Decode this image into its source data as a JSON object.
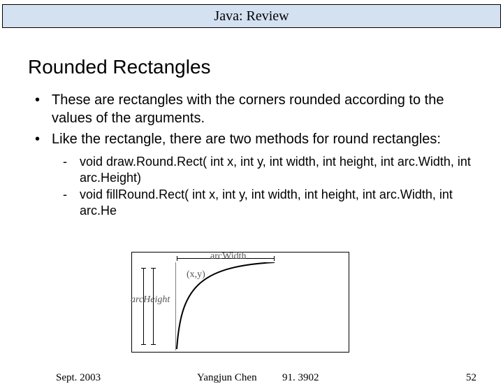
{
  "header": "Java: Review",
  "title": "Rounded Rectangles",
  "bullets": [
    "These are rectangles with the corners rounded according to\nthe values of the arguments.",
    "Like the rectangle, there are two methods for round rectangles:"
  ],
  "subitems": [
    "void draw.Round.Rect( int x, int y, int width, int height, int arc.Width, int arc.Height)",
    "void fillRound.Rect( int x, int y, int width, int height, int arc.Width, int arc.He"
  ],
  "diagram": {
    "arcWidth": "arcWidth",
    "xy": "(x,y)",
    "arcHeight": "arcHeight"
  },
  "footer": {
    "date": "Sept. 2003",
    "author": "Yangjun Chen",
    "course": "91. 3902",
    "page": "52"
  }
}
